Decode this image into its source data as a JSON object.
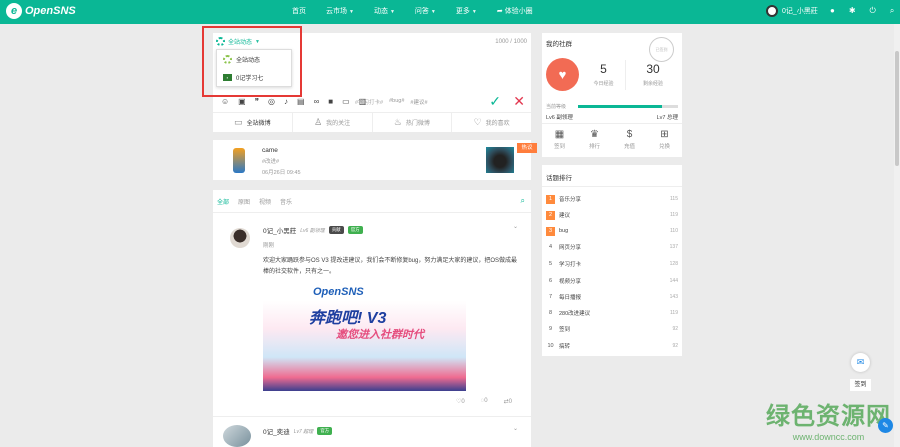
{
  "brand": {
    "name": "OpenSNS"
  },
  "nav": {
    "items": [
      {
        "label": "首页",
        "caret": false
      },
      {
        "label": "云市场",
        "caret": true
      },
      {
        "label": "动态",
        "caret": true
      },
      {
        "label": "问答",
        "caret": true
      },
      {
        "label": "更多",
        "caret": true
      },
      {
        "label": "体验小圈",
        "caret": false
      }
    ],
    "user_name": "0记_小黑莊"
  },
  "composer": {
    "counter": "1000 / 1000",
    "scope_toggle": "全站动态",
    "dropdown_options": [
      "全站动态",
      "0记学习七"
    ],
    "tags": [
      "#学习打卡#",
      "#bug#",
      "#建议#"
    ],
    "tabs": [
      "全站微博",
      "我的关注",
      "热门微博",
      "我的喜欢"
    ]
  },
  "music_card": {
    "name": "came",
    "tag": "#改进#",
    "time": "06月26日 09:45",
    "hot_label": "热议"
  },
  "feed": {
    "tabs": [
      "全部",
      "原图",
      "视频",
      "音乐"
    ],
    "post": {
      "author": "0记_小黑莊",
      "level": "Lv6 副领理",
      "badges": [
        "贡献",
        "官方"
      ],
      "meta": "刚刚",
      "body": "欢迎大家踊跃参与OS V3 提改进建议，我们会不断修复bug，努力满足大家的建议，把OS做成最棒的社交软件，只有之一。",
      "banner_logo": "OpenSNS",
      "banner_title": "奔跑吧! V3",
      "banner_subtitle": "邀您进入社群时代",
      "likes": "0",
      "comments": "0",
      "reposts": "0"
    },
    "post2": {
      "author": "0记_奕迪",
      "level": "Lv7 超理",
      "badge": "官方"
    }
  },
  "my_panel": {
    "title": "我的社群",
    "stamp": "已签到",
    "exp_today": "5",
    "exp_today_label": "今日经验",
    "exp_left": "30",
    "exp_left_label": "剩余经验",
    "level_label": "当前等级",
    "level_progress": 0.84,
    "level_current": "Lv6 副领理",
    "level_next": "Lv7 总理",
    "actions": [
      "签到",
      "排行",
      "充值",
      "兑换"
    ]
  },
  "ranking": {
    "title": "话题排行",
    "items": [
      {
        "num": "1",
        "name": "音乐分享",
        "count": "115"
      },
      {
        "num": "2",
        "name": "建议",
        "count": "119"
      },
      {
        "num": "3",
        "name": "bug",
        "count": "110"
      },
      {
        "num": "4",
        "name": "网页分享",
        "count": "137"
      },
      {
        "num": "5",
        "name": "学习打卡",
        "count": "128"
      },
      {
        "num": "6",
        "name": "视频分享",
        "count": "144"
      },
      {
        "num": "7",
        "name": "每日播报",
        "count": "143"
      },
      {
        "num": "8",
        "name": "280改进建议",
        "count": "119"
      },
      {
        "num": "9",
        "name": "签到",
        "count": "92"
      },
      {
        "num": "10",
        "name": "搞转",
        "count": "92"
      }
    ]
  },
  "side": {
    "sign_label": "签到"
  },
  "watermark": {
    "big": "绿色资源网",
    "small": "www.downcc.com"
  },
  "colors": {
    "accent": "#0ab795",
    "highlight_frame": "#e53935",
    "hot": "#ff8a3c"
  }
}
